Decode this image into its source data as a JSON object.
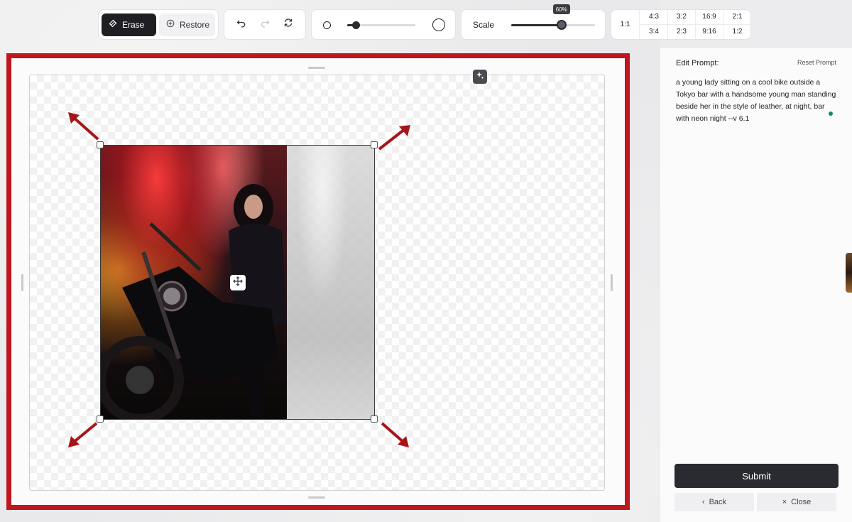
{
  "toolbar": {
    "erase_label": "Erase",
    "restore_label": "Restore",
    "brush_size": 0.12,
    "scale_label": "Scale",
    "scale_value": "60%",
    "scale_fraction": 0.6,
    "ratio_square": "1:1",
    "ratios": [
      "4:3",
      "3:2",
      "16:9",
      "2:1",
      "3:4",
      "2:3",
      "9:16",
      "1:2"
    ]
  },
  "panel": {
    "title": "Edit Prompt:",
    "reset_label": "Reset Prompt",
    "prompt": "a young lady sitting on a cool bike outside a Tokyo bar with a handsome young man standing beside her in the style of leather, at night, bar with neon night --v 6.1",
    "submit_label": "Submit",
    "back_label": "Back",
    "close_label": "Close"
  },
  "colors": {
    "frame_border": "#c0161e",
    "primary_button": "#2a2b30",
    "status_dot": "#138a5e"
  },
  "icons": {
    "erase": "eraser-icon",
    "restore": "plus-circle-icon",
    "undo": "undo-icon",
    "redo": "redo-icon",
    "reset": "refresh-icon",
    "magic": "sparkle-icon",
    "move": "move-icon"
  }
}
